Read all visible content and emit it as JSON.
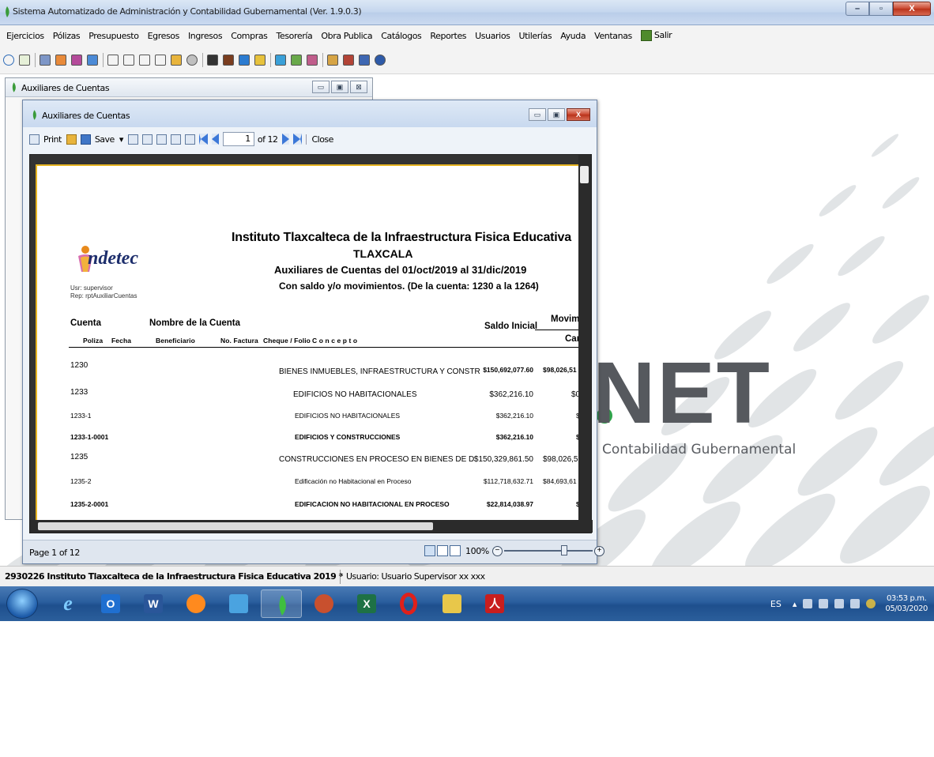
{
  "window": {
    "title": "Sistema Automatizado de Administración y Contabilidad Gubernamental  (Ver. 1.9.0.3)",
    "controls": [
      "–",
      "▫",
      "X"
    ]
  },
  "menu": {
    "items": [
      "Ejercicios",
      "Pólizas",
      "Presupuesto",
      "Egresos",
      "Ingresos",
      "Compras",
      "Tesorería",
      "Obra Publica",
      "Catálogos",
      "Reportes",
      "Usuarios",
      "Utilerías",
      "Ayuda",
      "Ventanas"
    ],
    "exit_label": "Salir"
  },
  "background_brand": {
    "logo": "NET",
    "subtitle": "Contabilidad Gubernamental",
    "accent_color": "#2ea44a"
  },
  "outer_window": {
    "title": "Auxiliares de Cuentas",
    "controls": [
      "▭",
      "▣",
      "⊠"
    ]
  },
  "report_window": {
    "title": "Auxiliares de Cuentas",
    "controls": [
      "▭",
      "▣",
      "X"
    ],
    "toolbar": {
      "print_label": "Print",
      "save_label": "Save",
      "page_value": "1",
      "page_total": "of 12",
      "close_label": "Close"
    },
    "status": {
      "page_label": "Page 1 of 12",
      "zoom": "100%"
    }
  },
  "report": {
    "logo_text": "ndetec",
    "user_line": "Usr: supervisor",
    "rep_line": "Rep: rptAuxiliarCuentas",
    "title": "Instituto Tlaxcalteca de la Infraestructura Fisica Educativa",
    "state": "TLAXCALA",
    "subtitle": "Auxiliares de Cuentas del 01/oct/2019 al 31/dic/2019",
    "filter": "Con saldo y/o movimientos. (De la cuenta: 1230 a la 1264)",
    "columns": {
      "cuenta": "Cuenta",
      "nombre": "Nombre de la Cuenta",
      "saldo": "Saldo Inicial",
      "movimientos": "Movimien",
      "cargo": "Car",
      "poliza": "Poliza",
      "fecha": "Fecha",
      "beneficiario": "Beneficiario",
      "factura": "No. Factura",
      "cheque": "Cheque / Folio",
      "concepto": "C o n c e p t o"
    },
    "rows": [
      {
        "code": "1230",
        "name": "BIENES INMUEBLES, INFRAESTRUCTURA Y CONSTR",
        "saldo": "$150,692,077.60",
        "cargo": "$98,026,51",
        "style": "top"
      },
      {
        "code": "1233",
        "name": "EDIFICIOS NO HABITACIONALES",
        "saldo": "$362,216.10",
        "cargo": "$0",
        "style": "lvl2"
      },
      {
        "code": "1233-1",
        "name": "EDIFICIOS NO HABITACIONALES",
        "saldo": "$362,216.10",
        "cargo": "$",
        "style": "sub"
      },
      {
        "code": "1233-1-0001",
        "name": "EDIFICIOS Y CONSTRUCCIONES",
        "saldo": "$362,216.10",
        "cargo": "$",
        "style": "bold"
      },
      {
        "code": "1235",
        "name": "CONSTRUCCIONES EN PROCESO EN BIENES DE D",
        "saldo": "$150,329,861.50",
        "cargo": "$98,026,51",
        "style": "lvl2"
      },
      {
        "code": "1235-2",
        "name": "Edificación no Habitacional en Proceso",
        "saldo": "$112,718,632.71",
        "cargo": "$84,693,61",
        "style": "sub"
      },
      {
        "code": "1235-2-0001",
        "name": "EDIFICACION NO HABITACIONAL EN PROCESO",
        "saldo": "$22,814,038.97",
        "cargo": "$",
        "style": "bold"
      }
    ]
  },
  "app_status": {
    "left": "2930226 Instituto Tlaxcalteca de la Infraestructura Fisica Educativa  2019   *",
    "user": "Usuario: Usuario Supervisor xx xxx"
  },
  "taskbar": {
    "apps": [
      "internet-explorer",
      "outlook",
      "word",
      "firefox",
      "network",
      "sistema-contable",
      "media-app",
      "excel",
      "opera",
      "file-explorer",
      "adobe-reader"
    ],
    "lang": "ES",
    "time": "03:53 p.m.",
    "date": "05/03/2020"
  }
}
